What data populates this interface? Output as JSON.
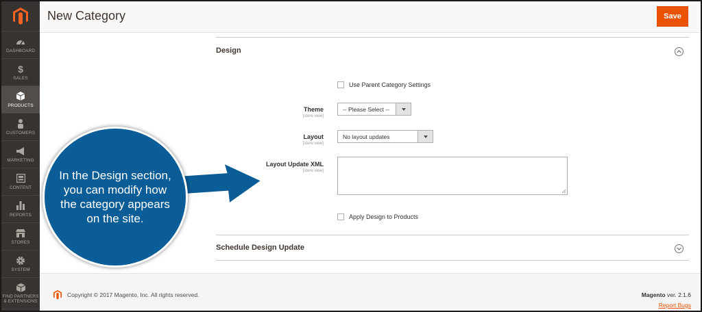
{
  "app": {
    "page_title": "New Category",
    "save_label": "Save",
    "brand_color": "#eb5202",
    "sidebar_color": "#373330"
  },
  "sidebar": {
    "items": [
      {
        "label": "DASHBOARD",
        "icon": "speedometer-icon"
      },
      {
        "label": "SALES",
        "icon": "dollar-icon"
      },
      {
        "label": "PRODUCTS",
        "icon": "cube-icon",
        "active": true
      },
      {
        "label": "CUSTOMERS",
        "icon": "person-icon"
      },
      {
        "label": "MARKETING",
        "icon": "megaphone-icon"
      },
      {
        "label": "CONTENT",
        "icon": "layout-icon"
      },
      {
        "label": "REPORTS",
        "icon": "bar-chart-icon"
      },
      {
        "label": "STORES",
        "icon": "storefront-icon"
      },
      {
        "label": "SYSTEM",
        "icon": "gear-icon"
      },
      {
        "label": "FIND PARTNERS & EXTENSIONS",
        "icon": "box-icon"
      }
    ]
  },
  "design": {
    "title": "Design",
    "use_parent_label": "Use Parent Category Settings",
    "theme_label": "Theme",
    "theme_scope": "[store view]",
    "theme_value": "-- Please Select --",
    "layout_label": "Layout",
    "layout_scope": "[store view]",
    "layout_value": "No layout updates",
    "xml_label": "Layout Update XML",
    "xml_scope": "[store view]",
    "apply_label": "Apply Design to Products"
  },
  "schedule": {
    "title": "Schedule Design Update"
  },
  "callout": {
    "text": "In the Design section, you can modify how the category appears on the site.",
    "color": "#0a5d96"
  },
  "footer": {
    "copyright": "Copyright © 2017 Magento, Inc. All rights reserved.",
    "brand": "Magento",
    "version": " ver. 2.1.6",
    "report_bugs": "Report Bugs"
  }
}
